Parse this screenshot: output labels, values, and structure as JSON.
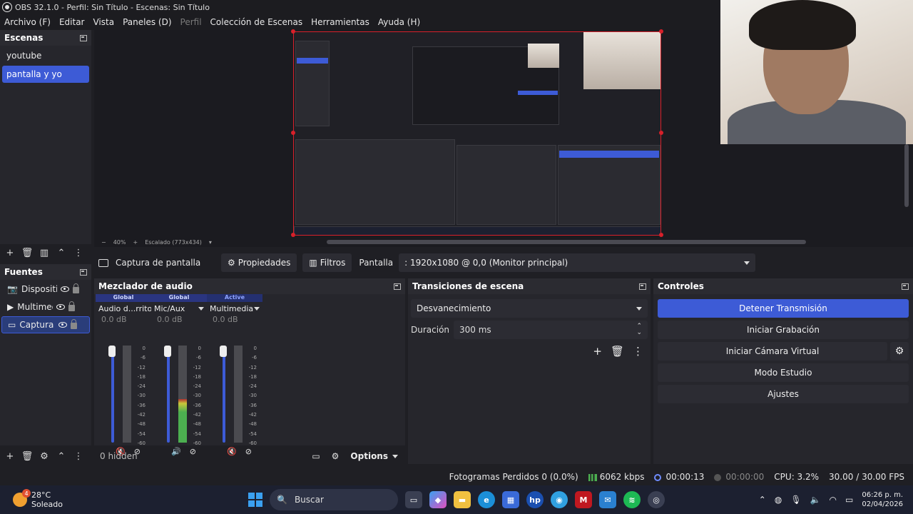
{
  "window": {
    "title": "OBS 32.1.0 - Perfil: Sin Título - Escenas: Sin Título"
  },
  "menu": [
    "Archivo (F)",
    "Editar",
    "Vista",
    "Paneles (D)",
    "Perfil",
    "Colección de Escenas",
    "Herramientas",
    "Ayuda (H)"
  ],
  "scenes": {
    "title": "Escenas",
    "items": [
      {
        "label": "youtube",
        "active": false
      },
      {
        "label": "pantalla y yo",
        "active": true
      }
    ]
  },
  "preview": {
    "zoom": "40%",
    "scaling": "Escalado (773x434)"
  },
  "source_bar": {
    "source_name": "Captura de pantalla",
    "properties_label": "Propiedades",
    "filters_label": "Filtros",
    "display_label": "Pantalla",
    "display_value": ": 1920x1080 @ 0,0 (Monitor principal)"
  },
  "sources": {
    "title": "Fuentes",
    "items": [
      {
        "label": "Dispositiv",
        "icon": "camera-icon",
        "active": false
      },
      {
        "label": "Multimed",
        "icon": "play-icon",
        "active": false
      },
      {
        "label": "Captura d",
        "icon": "monitor-icon",
        "active": true
      }
    ]
  },
  "mixer": {
    "title": "Mezclador de audio",
    "hidden_label": "0 hidden",
    "options_label": "Options",
    "scale": [
      "0",
      "-6",
      "-12",
      "-18",
      "-24",
      "-30",
      "-36",
      "-42",
      "-48",
      "-54",
      "-60"
    ],
    "channels": [
      {
        "tag": "Global",
        "name": "Audio d...rritorio",
        "db": "0.0 dB",
        "muted": true,
        "level": 0.0
      },
      {
        "tag": "Global",
        "name": "Mic/Aux",
        "db": "0.0 dB",
        "muted": false,
        "level": 0.45
      },
      {
        "tag": "Active",
        "name": "Multimedia",
        "db": "0.0 dB",
        "muted": true,
        "level": 0.0
      }
    ]
  },
  "transitions": {
    "title": "Transiciones de escena",
    "selected": "Desvanecimiento",
    "duration_label": "Duración",
    "duration_value": "300 ms"
  },
  "controls": {
    "title": "Controles",
    "stop_stream": "Detener Transmisión",
    "start_recording": "Iniciar Grabación",
    "start_virtual_cam": "Iniciar Cámara Virtual",
    "studio_mode": "Modo Estudio",
    "settings": "Ajustes"
  },
  "status": {
    "dropped_frames": "Fotogramas Perdidos 0 (0.0%)",
    "bitrate": "6062 kbps",
    "stream_time": "00:00:13",
    "rec_time": "00:00:00",
    "cpu": "CPU: 3.2%",
    "fps": "30.00 / 30.00 FPS"
  },
  "taskbar": {
    "weather_temp": "28°C",
    "weather_desc": "Soleado",
    "weather_badge": "4",
    "search_placeholder": "Buscar",
    "time": "06:26 p. m.",
    "date": "02/04/2026"
  },
  "colors": {
    "accent": "#3d5bd6",
    "source_outline": "#d8202a",
    "meter_green": "#4caf50"
  }
}
